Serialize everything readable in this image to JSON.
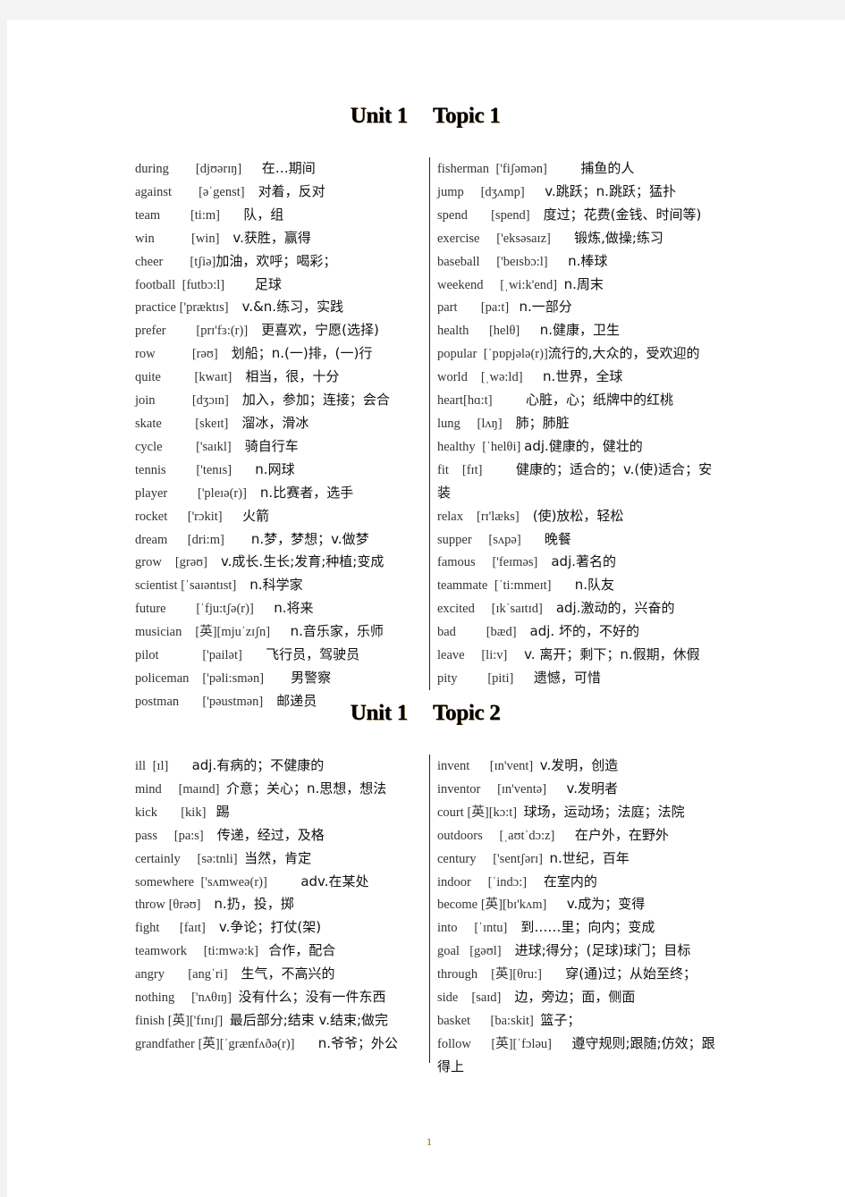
{
  "sections": [
    {
      "title_unit": "Unit 1",
      "title_topic": "Topic 1",
      "left": [
        {
          "word": "during",
          "phon": "[djʊərɪŋ]",
          "meaning": "在…期间",
          "g1": "        ",
          "g2": "      "
        },
        {
          "word": "against",
          "phon": "[əˈgenst]",
          "meaning": "对着，反对",
          "g1": "        ",
          "g2": "    "
        },
        {
          "word": "team",
          "phon": "[ti:m]",
          "meaning": "队，组",
          "g1": "         ",
          "g2": "       "
        },
        {
          "word": "win",
          "phon": "[win]",
          "meaning": "v.获胜，赢得",
          "g1": "           ",
          "g2": "    "
        },
        {
          "word": "cheer",
          "phon": "[tʃiə]",
          "meaning": "加油，欢呼；喝彩；",
          "g1": "        ",
          "g2": ""
        },
        {
          "word": "football",
          "phon": "[futbɔ:l]",
          "meaning": "足球",
          "g1": "  ",
          "g2": "         "
        },
        {
          "word": "practice",
          "phon": "['præktɪs]",
          "meaning": "v.&n.练习，实践",
          "g1": " ",
          "g2": "    "
        },
        {
          "word": "prefer",
          "phon": "[prɪ'fɜ:(r)]",
          "meaning": "更喜欢，宁愿(选择)",
          "g1": "         ",
          "g2": "    "
        },
        {
          "word": "row",
          "phon": "[rəʊ]",
          "meaning": "划船；n.(一)排，(一)行",
          "g1": "           ",
          "g2": "    "
        },
        {
          "word": "quite",
          "phon": "[kwaɪt]",
          "meaning": "相当，很，十分",
          "g1": "          ",
          "g2": "    "
        },
        {
          "word": "join",
          "phon": "[dʒɔɪn]",
          "meaning": "加入，参加；连接；会合",
          "g1": "           ",
          "g2": "    "
        },
        {
          "word": "skate",
          "phon": "[skeɪt]",
          "meaning": "溜冰，滑冰",
          "g1": "          ",
          "g2": "    "
        },
        {
          "word": "cycle",
          "phon": "['saɪkl]",
          "meaning": "骑自行车",
          "g1": "          ",
          "g2": "    "
        },
        {
          "word": "tennis",
          "phon": "['tenɪs]",
          "meaning": "n.网球",
          "g1": "         ",
          "g2": "       "
        },
        {
          "word": "player",
          "phon": "['pleɪə(r)]",
          "meaning": "n.比赛者，选手",
          "g1": "         ",
          "g2": "    "
        },
        {
          "word": "rocket",
          "phon": "['rɔkit]",
          "meaning": "火箭",
          "g1": "      ",
          "g2": "      "
        },
        {
          "word": "dream",
          "phon": "[dri:m]",
          "meaning": "n.梦，梦想；v.做梦",
          "g1": "      ",
          "g2": "        "
        },
        {
          "word": "grow",
          "phon": "[grəʊ]",
          "meaning": "v.成长.生长;发育;种植;变成",
          "g1": "    ",
          "g2": "    "
        },
        {
          "word": "scientist",
          "phon": "[ˈsaɪəntɪst]",
          "meaning": "n.科学家",
          "g1": " ",
          "g2": "    "
        },
        {
          "word": "future",
          "phon": "[ˈfju:tʃə(r)]",
          "meaning": "n.将来",
          "g1": "         ",
          "g2": "      "
        },
        {
          "word": "musician",
          "phon": "[英][mjuˈzɪʃn]",
          "meaning": "n.音乐家，乐师",
          "g1": "    ",
          "g2": "      "
        },
        {
          "word": "pilot",
          "phon": "['pailət]",
          "meaning": "飞行员，驾驶员",
          "g1": "             ",
          "g2": "       "
        },
        {
          "word": "policeman",
          "phon": "['pəli:smən]",
          "meaning": "男警察",
          "g1": "    ",
          "g2": "        "
        },
        {
          "word": "postman",
          "phon": "['pəustmən]",
          "meaning": "邮递员",
          "g1": "       ",
          "g2": "    "
        }
      ],
      "right": [
        {
          "word": "fisherman",
          "phon": "['fiʃəmən]",
          "meaning": "捕鱼的人",
          "g1": "  ",
          "g2": "          "
        },
        {
          "word": "jump",
          "phon": "[dʒʌmp]",
          "meaning": "v.跳跃；n.跳跃；猛扑",
          "g1": "     ",
          "g2": "      "
        },
        {
          "word": "spend",
          "phon": "[spend]",
          "meaning": "度过；花费(金钱、时间等)",
          "g1": "       ",
          "g2": "    "
        },
        {
          "word": "exercise",
          "phon": "['eksəsaɪz]",
          "meaning": "锻炼,做操;练习",
          "g1": "     ",
          "g2": "       "
        },
        {
          "word": "baseball",
          "phon": "['beɪsbɔ:l]",
          "meaning": "n.棒球",
          "g1": "     ",
          "g2": "      "
        },
        {
          "word": "weekend",
          "phon": "[ˌwi:k'end]",
          "meaning": "n.周末",
          "g1": "     ",
          "g2": "  "
        },
        {
          "word": "part",
          "phon": "[pa:t]",
          "meaning": "n.一部分",
          "g1": "       ",
          "g2": "   "
        },
        {
          "word": "health",
          "phon": "[helθ]",
          "meaning": "n.健康，卫生",
          "g1": "      ",
          "g2": "      "
        },
        {
          "word": "popular",
          "phon": "[ˈpɒpjələ(r)]",
          "meaning": "流行的,大众的，受欢迎的",
          "g1": "  ",
          "g2": ""
        },
        {
          "word": "world",
          "phon": "[ˌwə:ld]",
          "meaning": "n.世界，全球",
          "g1": "    ",
          "g2": "      "
        },
        {
          "word": "heart",
          "phon": "[hɑ:t]",
          "meaning": "心脏，心；纸牌中的红桃",
          "g1": "",
          "g2": "          "
        },
        {
          "word": "lung",
          "phon": "[lʌŋ]",
          "meaning": "肺；肺脏",
          "g1": "     ",
          "g2": "    "
        },
        {
          "word": "healthy",
          "phon": "[ˈhelθi]",
          "meaning": "adj.健康的，健壮的",
          "g1": "  ",
          "g2": " "
        },
        {
          "word": "fit",
          "phon": "[fɪt]",
          "meaning": "健康的；适合的；v.(使)适合；安装",
          "g1": "    ",
          "g2": "          "
        },
        {
          "word": "relax",
          "phon": "[rɪ'læks]",
          "meaning": "(使)放松，轻松",
          "g1": "    ",
          "g2": "    "
        },
        {
          "word": "supper",
          "phon": "[sʌpə]",
          "meaning": "晚餐",
          "g1": "     ",
          "g2": "       "
        },
        {
          "word": "famous",
          "phon": "['feɪməs]",
          "meaning": "adj.著名的",
          "g1": "     ",
          "g2": "    "
        },
        {
          "word": "teammate",
          "phon": "[ˈti:mmeɪt]",
          "meaning": "n.队友",
          "g1": "  ",
          "g2": "       "
        },
        {
          "word": "excited",
          "phon": "[ɪkˈsaɪtɪd]",
          "meaning": "adj.激动的，兴奋的",
          "g1": "     ",
          "g2": "    "
        },
        {
          "word": "bad",
          "phon": "[bæd]",
          "meaning": "adj. 坏的，不好的",
          "g1": "         ",
          "g2": "    "
        },
        {
          "word": "leave",
          "phon": "[li:v]",
          "meaning": "v.  离开；剩下；n.假期，休假",
          "g1": "     ",
          "g2": "     "
        },
        {
          "word": "pity",
          "phon": "[piti]",
          "meaning": "遗憾，可惜",
          "g1": "         ",
          "g2": "      "
        }
      ]
    },
    {
      "title_unit": "Unit 1",
      "title_topic": "Topic 2",
      "left": [
        {
          "word": "ill",
          "phon": "[ɪl]",
          "meaning": "adj.有病的；不健康的",
          "g1": "  ",
          "g2": "       "
        },
        {
          "word": "mind",
          "phon": "[maɪnd]",
          "meaning": "介意；关心；n.思想，想法",
          "g1": "     ",
          "g2": "  "
        },
        {
          "word": "kick",
          "phon": "[kik]",
          "meaning": "踢",
          "g1": "       ",
          "g2": "   "
        },
        {
          "word": "pass",
          "phon": "[pa:s]",
          "meaning": "传递，经过，及格",
          "g1": "     ",
          "g2": "    "
        },
        {
          "word": "certainly",
          "phon": "[sə:tnli]",
          "meaning": "当然，肯定",
          "g1": "     ",
          "g2": "  "
        },
        {
          "word": "somewhere",
          "phon": "['sʌmweə(r)]",
          "meaning": "adv.在某处",
          "g1": "  ",
          "g2": "          "
        },
        {
          "word": "throw",
          "phon": "[θrəʊ]",
          "meaning": "n.扔，投，掷",
          "g1": " ",
          "g2": "    "
        },
        {
          "word": "fight",
          "phon": "[faɪt]",
          "meaning": "v.争论；打仗(架)",
          "g1": "      ",
          "g2": "    "
        },
        {
          "word": "teamwork",
          "phon": "[ti:mwə:k]",
          "meaning": "合作，配合",
          "g1": "     ",
          "g2": "   "
        },
        {
          "word": "angry",
          "phon": "[angˈri]",
          "meaning": "生气，不高兴的",
          "g1": "       ",
          "g2": "    "
        },
        {
          "word": "nothing",
          "phon": "['nʌθɪŋ]",
          "meaning": "没有什么；没有一件东西",
          "g1": "     ",
          "g2": "  "
        },
        {
          "word": "finish",
          "phon": "[英]['fɪnɪʃ]",
          "meaning": "最后部分;结束 v.结束;做完",
          "g1": " ",
          "g2": "  "
        },
        {
          "word": "grandfather",
          "phon": "[英][ˈgrænfʌðə(r)]",
          "meaning": "n.爷爷；外公",
          "g1": " ",
          "g2": "       "
        }
      ],
      "right": [
        {
          "word": "invent",
          "phon": "[ɪn'vent]",
          "meaning": "v.发明，创造",
          "g1": "      ",
          "g2": "  "
        },
        {
          "word": "inventor",
          "phon": "[ɪn'ventə]",
          "meaning": "v.发明者",
          "g1": "     ",
          "g2": "      "
        },
        {
          "word": "court",
          "phon": "[英][kɔ:t]",
          "meaning": "球场，运动场；法庭；法院",
          "g1": " ",
          "g2": "  "
        },
        {
          "word": "outdoors",
          "phon": "[ˌaʊtˈdɔ:z]",
          "meaning": "在户外，在野外",
          "g1": "     ",
          "g2": "      "
        },
        {
          "word": "century",
          "phon": "['sentʃərɪ]",
          "meaning": "n.世纪，百年",
          "g1": "     ",
          "g2": "  "
        },
        {
          "word": "indoor",
          "phon": "[ˈindɔ:]",
          "meaning": "在室内的",
          "g1": "     ",
          "g2": "     "
        },
        {
          "word": "become",
          "phon": "[英][bɪ'kʌm]",
          "meaning": "v.成为；变得",
          "g1": " ",
          "g2": "      "
        },
        {
          "word": "into",
          "phon": "[ˈɪntu]",
          "meaning": "到……里；向内；变成",
          "g1": "     ",
          "g2": "    "
        },
        {
          "word": "goal",
          "phon": "[gəʊl]",
          "meaning": "进球;得分；(足球)球门；目标",
          "g1": "   ",
          "g2": "    "
        },
        {
          "word": "through",
          "phon": "[英][θru:]",
          "meaning": "穿(通)过；从始至终；",
          "g1": "    ",
          "g2": "       "
        },
        {
          "word": "side",
          "phon": "[saɪd]",
          "meaning": "边，旁边；面，侧面",
          "g1": "    ",
          "g2": "    "
        },
        {
          "word": "basket",
          "phon": "[ba:skit]",
          "meaning": "篮子；",
          "g1": "      ",
          "g2": "  "
        },
        {
          "word": "follow",
          "phon": "[英][ˈfɔləu]",
          "meaning": "遵守规则;跟随;仿效；跟得上",
          "g1": "      ",
          "g2": "      "
        }
      ]
    }
  ],
  "page_number": "1",
  "colors": {
    "page_background": "#f3f3f3",
    "sheet": "#ffffff",
    "text": "#111111",
    "page_number": "#8a5a00"
  }
}
